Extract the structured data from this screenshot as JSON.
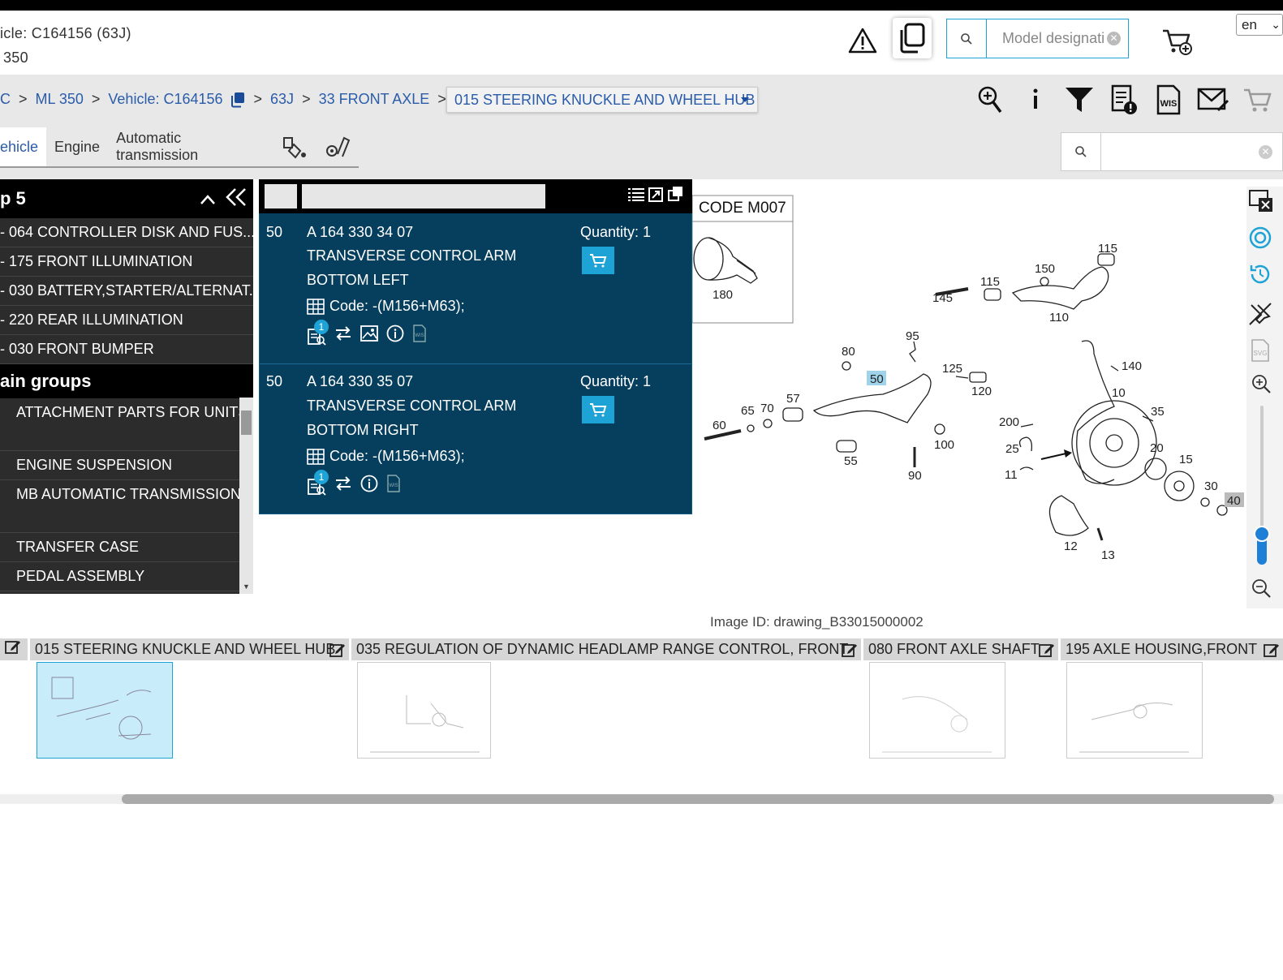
{
  "header": {
    "vehicle_line": "icle: C164156 (63J)",
    "model_line": "350",
    "search_placeholder": "Model designati",
    "language": "en"
  },
  "breadcrumb": {
    "items": [
      "C",
      "ML 350",
      "Vehicle: C164156",
      "63J",
      "33 FRONT AXLE"
    ],
    "separator": ">",
    "current": "015 STEERING KNUCKLE AND WHEEL HUB"
  },
  "tabs": [
    "ehicle",
    "Engine",
    "Automatic transmission"
  ],
  "left_panel": {
    "top5_title": "p 5",
    "top5_items": [
      "- 064 CONTROLLER DISK AND FUS...",
      "- 175 FRONT ILLUMINATION",
      "- 030 BATTERY,STARTER/ALTERNAT...",
      "- 220 REAR ILLUMINATION",
      "- 030 FRONT BUMPER"
    ],
    "main_groups_title": "ain groups",
    "main_groups": [
      "ATTACHMENT PARTS FOR UNITS",
      "ENGINE SUSPENSION",
      "MB AUTOMATIC TRANSMISSION",
      "TRANSFER CASE",
      "PEDAL ASSEMBLY"
    ]
  },
  "parts": [
    {
      "position": "50",
      "part_number": "A 164 330 34 07",
      "description_line1": "TRANSVERSE CONTROL ARM",
      "description_line2": "BOTTOM LEFT",
      "quantity": "Quantity: 1",
      "code": "Code: -(M156+M63);",
      "badge": "1"
    },
    {
      "position": "50",
      "part_number": "A 164 330 35 07",
      "description_line1": "TRANSVERSE CONTROL ARM",
      "description_line2": "BOTTOM RIGHT",
      "quantity": "Quantity: 1",
      "code": "Code: -(M156+M63);",
      "badge": "1"
    }
  ],
  "diagram": {
    "code_label": "CODE M007",
    "image_id": "Image ID: drawing_B33015000002",
    "callouts": [
      "180",
      "115",
      "115",
      "150",
      "145",
      "110",
      "95",
      "80",
      "50",
      "125",
      "120",
      "140",
      "10",
      "57",
      "70",
      "65",
      "60",
      "200",
      "35",
      "25",
      "20",
      "15",
      "11",
      "100",
      "55",
      "90",
      "30",
      "40",
      "12",
      "13"
    ]
  },
  "thumbnails": [
    {
      "label": "015 STEERING KNUCKLE AND WHEEL HUB"
    },
    {
      "label": "035 REGULATION OF DYNAMIC HEADLAMP RANGE CONTROL, FRONT"
    },
    {
      "label": "080 FRONT AXLE SHAFT"
    },
    {
      "label": "195 AXLE HOUSING,FRONT"
    }
  ],
  "colors": {
    "accent": "#1ea3d6",
    "part_bg": "#063f5e",
    "link": "#2a5caa",
    "highlight": "#9fd3ea"
  }
}
